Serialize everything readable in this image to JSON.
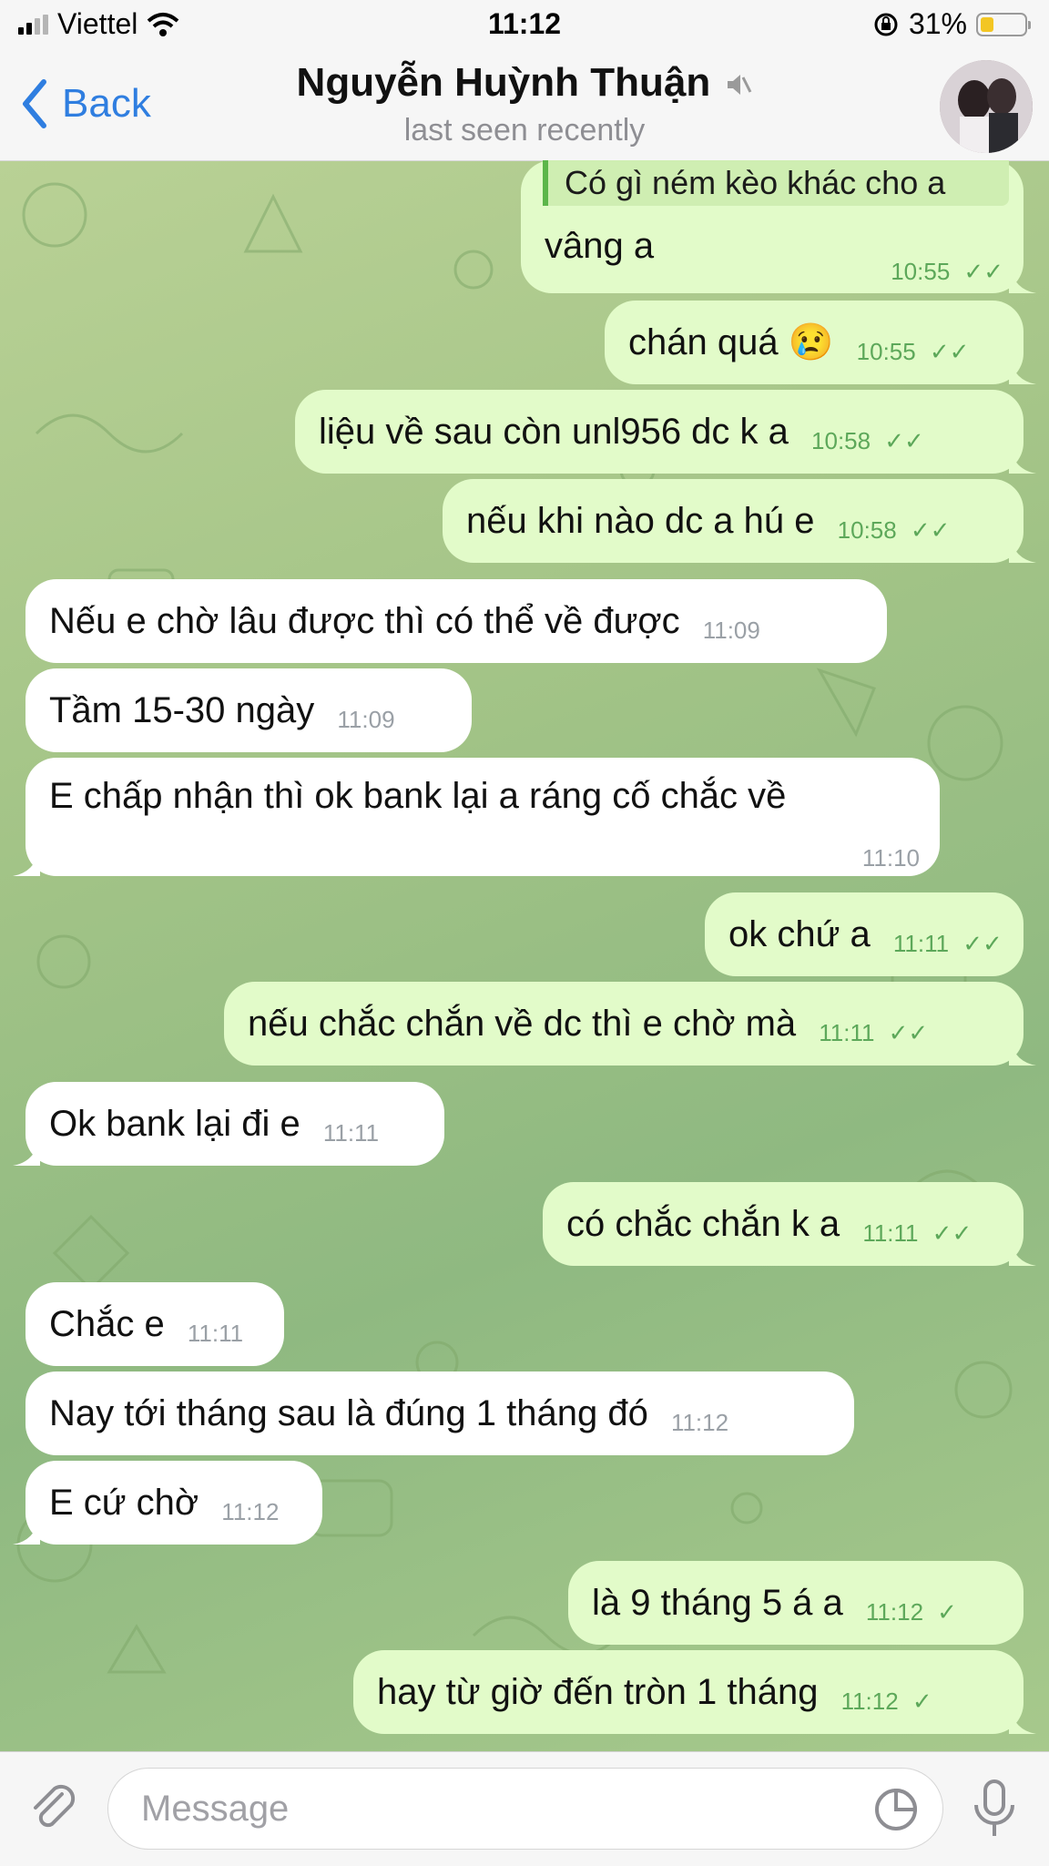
{
  "status_bar": {
    "carrier": "Viettel",
    "time": "11:12",
    "battery": "31%"
  },
  "header": {
    "back_label": "Back",
    "title": "Nguyễn Huỳnh Thuận",
    "subtitle": "last seen recently"
  },
  "messages": [
    {
      "dir": "out",
      "reply_quote": "Có gì ném kèo khác cho a",
      "text": "vâng a",
      "time": "10:55",
      "read": true
    },
    {
      "dir": "out",
      "text": "chán quá",
      "emoji": "😢",
      "time": "10:55",
      "read": true
    },
    {
      "dir": "out",
      "text": "liệu về sau còn unl956 dc k a",
      "time": "10:58",
      "read": true
    },
    {
      "dir": "out",
      "text": "nếu khi nào dc a hú e",
      "time": "10:58",
      "read": true
    },
    {
      "dir": "in",
      "text": "Nếu e chờ lâu được thì có thể về được",
      "time": "11:09"
    },
    {
      "dir": "in",
      "text": "Tầm 15-30 ngày",
      "time": "11:09"
    },
    {
      "dir": "in",
      "text": "E chấp nhận thì ok bank lại a ráng cố chắc về",
      "time": "11:10"
    },
    {
      "dir": "out",
      "text": "ok chứ a",
      "time": "11:11",
      "read": true
    },
    {
      "dir": "out",
      "text": "nếu chắc chắn về dc thì e chờ mà",
      "time": "11:11",
      "read": true
    },
    {
      "dir": "in",
      "text": "Ok bank lại đi e",
      "time": "11:11"
    },
    {
      "dir": "out",
      "text": "có chắc chắn k a",
      "time": "11:11",
      "read": true
    },
    {
      "dir": "in",
      "text": "Chắc e",
      "time": "11:11"
    },
    {
      "dir": "in",
      "text": "Nay tới tháng sau là đúng 1 tháng đó",
      "time": "11:12"
    },
    {
      "dir": "in",
      "text": "E cứ chờ",
      "time": "11:12"
    },
    {
      "dir": "out",
      "text": "là 9 tháng 5 á a",
      "time": "11:12",
      "read": false
    },
    {
      "dir": "out",
      "text": "hay từ giờ đến tròn 1 tháng",
      "time": "11:12",
      "read": false
    }
  ],
  "composer": {
    "placeholder": "Message"
  },
  "colors": {
    "accent": "#2f7ee0",
    "outgoing_bubble": "#e2fbc9",
    "incoming_bubble": "#ffffff",
    "read_check": "#5da85a"
  }
}
